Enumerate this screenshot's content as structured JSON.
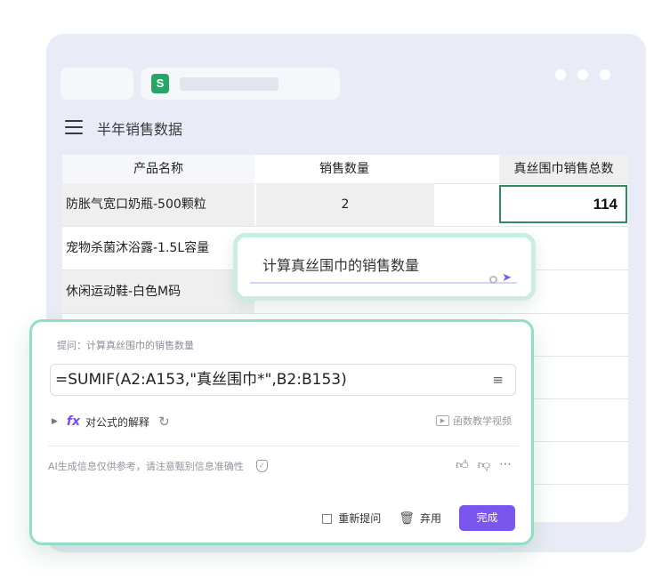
{
  "app": {
    "logo_letter": "S",
    "doc_title": "半年销售数据"
  },
  "sheet": {
    "headers": [
      "产品名称",
      "销售数量",
      "真丝围巾销售总数"
    ],
    "rows": [
      {
        "name": "防胀气宽口奶瓶-500颗粒",
        "qty": "2"
      },
      {
        "name": "宠物杀菌沐浴露-1.5L容量",
        "qty": ""
      },
      {
        "name": "休闲运动鞋-白色M码",
        "qty": ""
      }
    ],
    "selected_value": "114"
  },
  "mini_prompt": {
    "text": "计算真丝围巾的销售数量"
  },
  "ai_panel": {
    "prompt_label": "提问：计算真丝围巾的销售数量",
    "formula": "=SUMIF(A2:A153,\"真丝围巾*\",B2:B153)",
    "explain_label": "对公式的解释",
    "fx_label": "fx",
    "video_link": "函数教学视频",
    "disclaimer": "AI生成信息仅供参考，请注意甄别信息准确性",
    "reprompt_label": "重新提问",
    "discard_label": "弃用",
    "done_label": "完成"
  },
  "colors": {
    "accent": "#7a55ee",
    "highlight_border": "#2f8c61",
    "panel_border": "#8fe0c3",
    "sheet_logo": "#27a567"
  },
  "icons": [
    "menu-icon",
    "sheet-logo-icon",
    "send-icon",
    "format-icon",
    "fx-icon",
    "refresh-icon",
    "play-icon",
    "shield-icon",
    "thumbs-up-icon",
    "thumbs-down-icon",
    "more-icon",
    "reprompt-icon",
    "trash-icon"
  ]
}
